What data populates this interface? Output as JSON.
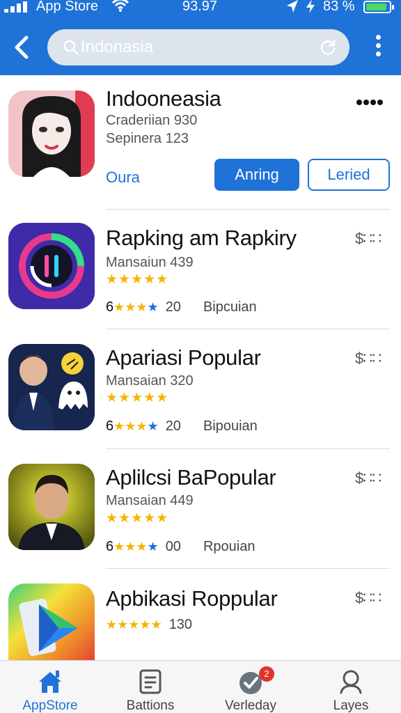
{
  "status_bar": {
    "carrier": "App Store",
    "time": "93.97",
    "battery_text": "83 %",
    "battery_level": 0.9,
    "battery_color": "#4cd964"
  },
  "nav": {
    "back_icon": "chevron-left-icon",
    "search_placeholder": "Indonasia",
    "search_icon": "search-icon",
    "refresh_icon": "refresh-icon",
    "more_icon": "more-vertical-icon"
  },
  "featured": {
    "title": "Indooneasia",
    "line1": "Craderiian 930",
    "line2": "Sepinera 123",
    "link": "Oura",
    "primary_button": "Anring",
    "secondary_button": "Leried",
    "more_icon": "more-horizontal-icon"
  },
  "apps": [
    {
      "title": "Rapking am Rapkiry",
      "subtitle": "Mansaiun 439",
      "stars": "★★★★★",
      "meta_lead": "6",
      "meta_stars_y": "★★★",
      "meta_stars_b": "★",
      "count": "20",
      "category": "Bipcuian",
      "price": "$∷∷"
    },
    {
      "title": "Apariasi Popular",
      "subtitle": "Mansaian 320",
      "stars": "★★★★★",
      "meta_lead": "6",
      "meta_stars_y": "★★★",
      "meta_stars_b": "★",
      "count": "20",
      "category": "Bipouian",
      "price": "$∷∷"
    },
    {
      "title": "Aplilcsi BaPopular",
      "subtitle": "Mansaian 449",
      "stars": "★★★★★",
      "meta_lead": "6",
      "meta_stars_y": "★★★",
      "meta_stars_b": "★",
      "count": "00",
      "category": "Rpouian",
      "price": "$∷∷"
    },
    {
      "title": "Apbikasi Roppular",
      "stars": "★★★★★",
      "count": "130",
      "price": "$∷∷"
    }
  ],
  "tabbar": {
    "tabs": [
      {
        "label": "AppStore",
        "icon": "home-icon",
        "active": true
      },
      {
        "label": "Battions",
        "icon": "document-icon",
        "active": false
      },
      {
        "label": "Verleday",
        "icon": "checkmark-icon",
        "active": false,
        "badge": "2"
      },
      {
        "label": "Layes",
        "icon": "search-icon",
        "active": false
      }
    ]
  },
  "colors": {
    "accent": "#1f72d8",
    "star": "#f5b400",
    "badge": "#e0342b"
  }
}
